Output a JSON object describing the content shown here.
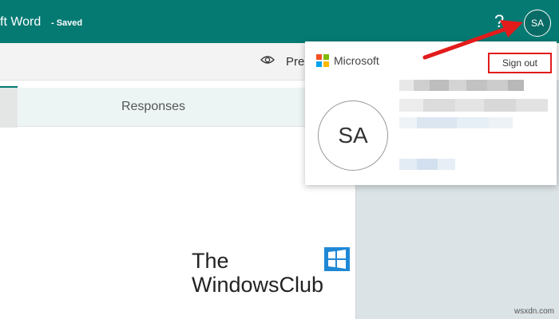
{
  "header": {
    "doc_title": "ft Word",
    "status": "- Saved",
    "help": "?",
    "avatar_initials": "SA"
  },
  "toolbar": {
    "preview_label": "Pre"
  },
  "tabs": {
    "responses_label": "Responses"
  },
  "account_menu": {
    "brand": "Microsoft",
    "sign_out_label": "Sign out",
    "avatar_initials": "SA"
  },
  "watermark": {
    "line1": "The",
    "line2": "WindowsClub"
  },
  "credit": "wsxdn.com",
  "colors": {
    "header_bg": "#047a73",
    "highlight_red": "#e21b1b",
    "ms_red": "#f25022",
    "ms_green": "#7fba00",
    "ms_blue": "#00a4ef",
    "ms_yellow": "#ffb900"
  }
}
